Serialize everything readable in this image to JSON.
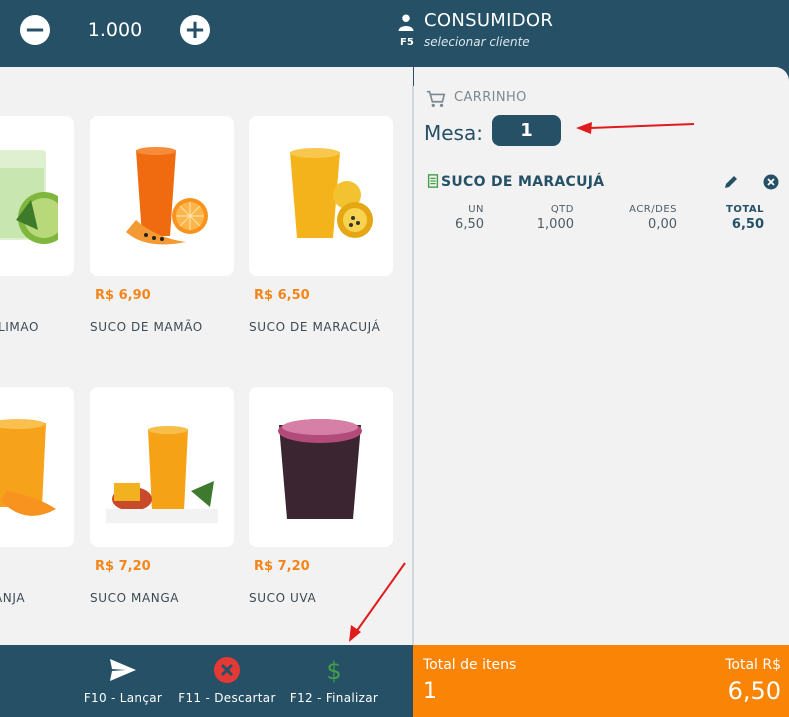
{
  "topbar": {
    "quantity": "1.000",
    "customer_key": "F5",
    "customer_name": "CONSUMIDOR",
    "customer_sub": "selecionar cliente"
  },
  "products": [
    {
      "name": "LIMAO",
      "price": "",
      "image": "lime-juice-image"
    },
    {
      "name": "SUCO DE MAMÃO",
      "price": "R$ 6,90",
      "image": "papaya-juice-image"
    },
    {
      "name": "SUCO DE MARACUJÁ",
      "price": "R$ 6,50",
      "image": "passion-fruit-juice-image"
    },
    {
      "name": "ANJA",
      "price": "",
      "image": "orange-juice-image"
    },
    {
      "name": "SUCO MANGA",
      "price": "R$ 7,20",
      "image": "mango-juice-image"
    },
    {
      "name": "SUCO UVA",
      "price": "R$ 7,20",
      "image": "grape-juice-image"
    }
  ],
  "cart": {
    "title": "CARRINHO",
    "mesa_label": "Mesa:",
    "mesa_value": "1",
    "item": {
      "name": "SUCO DE MARACUJÁ",
      "headers": [
        "UN",
        "QTD",
        "ACR/DES",
        "TOTAL"
      ],
      "values": [
        "6,50",
        "1,000",
        "0,00",
        "6,50"
      ]
    }
  },
  "actions": [
    {
      "label": "F10 - Lançar",
      "icon": "send-icon",
      "color": "#ffffff"
    },
    {
      "label": "F11 - Descartar",
      "icon": "discard-icon",
      "color": "#e53935"
    },
    {
      "label": "F12 - Finalizar",
      "icon": "dollar-icon",
      "color": "#43a047"
    }
  ],
  "totals": {
    "items_label": "Total de itens",
    "items_value": "1",
    "total_label": "Total R$",
    "total_value": "6,50"
  },
  "colors": {
    "primary": "#255066",
    "accent": "#fa8405",
    "price": "#f3861a"
  }
}
